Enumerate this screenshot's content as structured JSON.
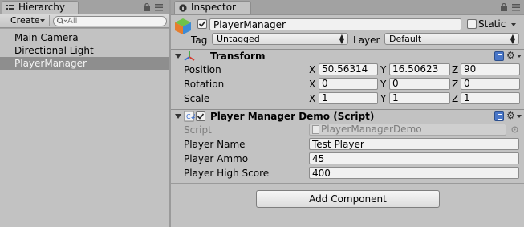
{
  "hierarchy": {
    "tab_label": "Hierarchy",
    "create_label": "Create",
    "search_placeholder": "All",
    "items": [
      {
        "label": "Main Camera"
      },
      {
        "label": "Directional Light"
      },
      {
        "label": "PlayerManager",
        "selected": true
      }
    ]
  },
  "inspector": {
    "tab_label": "Inspector",
    "object_name": "PlayerManager",
    "static_label": "Static",
    "tag_label": "Tag",
    "tag_value": "Untagged",
    "layer_label": "Layer",
    "layer_value": "Default",
    "transform": {
      "title": "Transform",
      "rows": [
        {
          "label": "Position",
          "x": "50.56314",
          "y": "16.50623",
          "z": "90"
        },
        {
          "label": "Rotation",
          "x": "0",
          "y": "0",
          "z": "0"
        },
        {
          "label": "Scale",
          "x": "1",
          "y": "1",
          "z": "1"
        }
      ]
    },
    "script_component": {
      "title": "Player Manager Demo (Script)",
      "script_label": "Script",
      "script_value": "PlayerManagerDemo",
      "fields": [
        {
          "label": "Player Name",
          "value": "Test Player"
        },
        {
          "label": "Player Ammo",
          "value": "45"
        },
        {
          "label": "Player High Score",
          "value": "400"
        }
      ]
    },
    "add_component_label": "Add Component"
  },
  "axis_labels": {
    "x": "X",
    "y": "Y",
    "z": "Z"
  },
  "colors": {
    "panel_bg": "#c2c2c2",
    "selection": "#8e8e8e",
    "help_icon": "#4a77c8"
  }
}
